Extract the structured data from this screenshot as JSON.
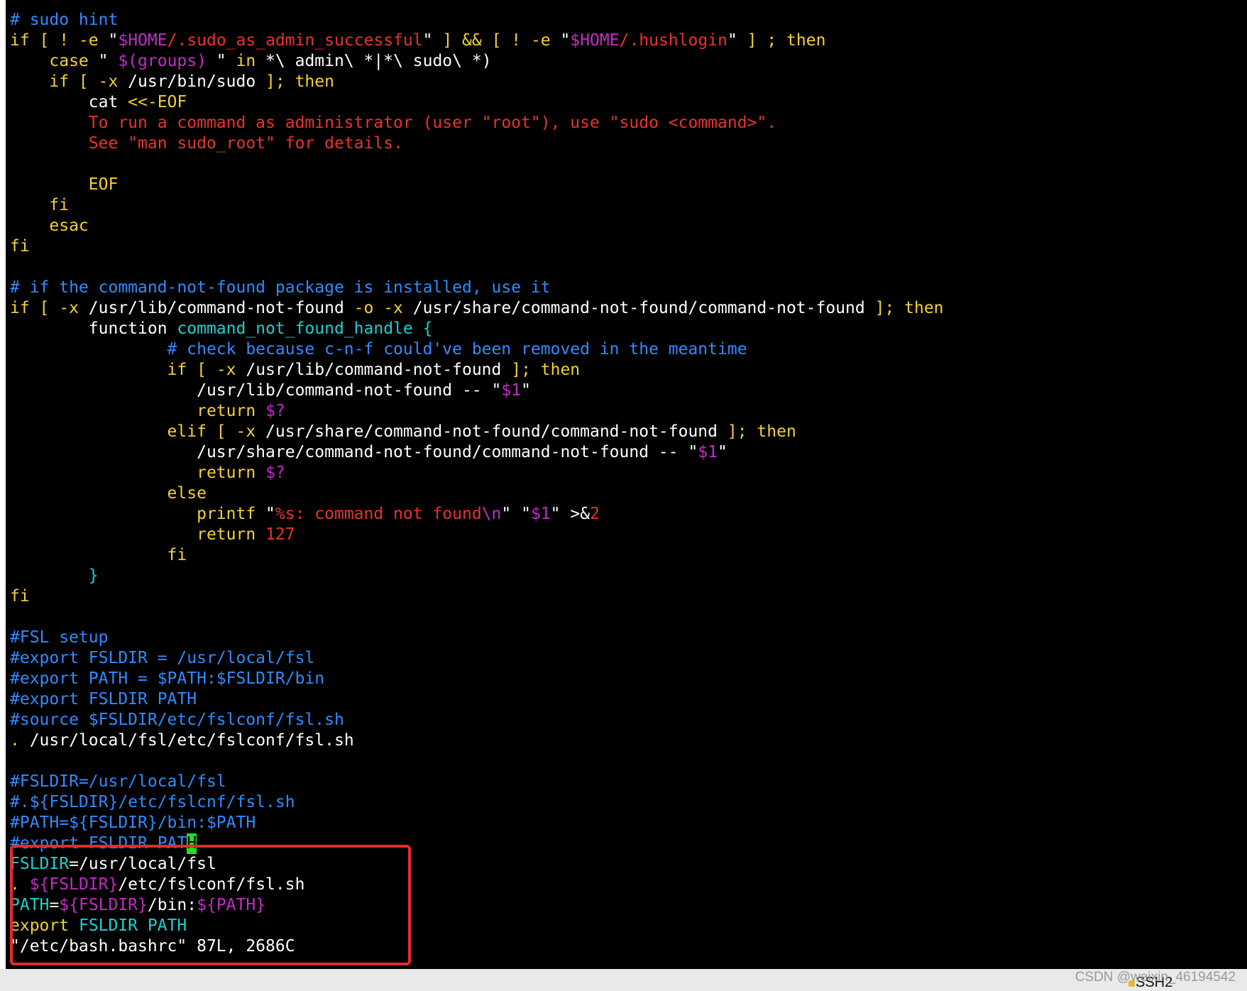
{
  "palette": {
    "default": "#ffffff",
    "keyword": "#f2d03a",
    "comment": "#2f8cff",
    "string": "#e8332d",
    "variable": "#c42ac8",
    "identifier": "#19d2d2",
    "cursor": "#21e021",
    "highlight_box": "#e62a2a"
  },
  "terminal": {
    "lines": [
      [
        {
          "t": "# sudo hint",
          "c": "comment"
        }
      ],
      [
        {
          "t": "if [ ! -e ",
          "c": "keyword"
        },
        {
          "t": "\"",
          "c": "default"
        },
        {
          "t": "$HOME",
          "c": "variable"
        },
        {
          "t": "/.sudo_as_admin_successful",
          "c": "string"
        },
        {
          "t": "\"",
          "c": "default"
        },
        {
          "t": " ] && [ ! -e ",
          "c": "keyword"
        },
        {
          "t": "\"",
          "c": "default"
        },
        {
          "t": "$HOME",
          "c": "variable"
        },
        {
          "t": "/.hushlogin",
          "c": "string"
        },
        {
          "t": "\"",
          "c": "default"
        },
        {
          "t": " ] ; then",
          "c": "keyword"
        }
      ],
      [
        {
          "t": "    case ",
          "c": "keyword"
        },
        {
          "t": "\" ",
          "c": "default"
        },
        {
          "t": "$(groups)",
          "c": "variable"
        },
        {
          "t": " \" ",
          "c": "default"
        },
        {
          "t": "in",
          "c": "keyword"
        },
        {
          "t": " *\\ admin\\ *|*\\ sudo\\ *)",
          "c": "default"
        }
      ],
      [
        {
          "t": "    if [ -x ",
          "c": "keyword"
        },
        {
          "t": "/usr/bin/sudo",
          "c": "default"
        },
        {
          "t": " ]; then",
          "c": "keyword"
        }
      ],
      [
        {
          "t": "        cat ",
          "c": "default"
        },
        {
          "t": "<<-EOF",
          "c": "keyword"
        }
      ],
      [
        {
          "t": "        To run a command as administrator (user \"root\"), use \"sudo <command>\".",
          "c": "string"
        }
      ],
      [
        {
          "t": "        See \"man sudo_root\" for details.",
          "c": "string"
        }
      ],
      [
        {
          "t": "",
          "c": "default"
        }
      ],
      [
        {
          "t": "        EOF",
          "c": "keyword"
        }
      ],
      [
        {
          "t": "    fi",
          "c": "keyword"
        }
      ],
      [
        {
          "t": "    esac",
          "c": "keyword"
        }
      ],
      [
        {
          "t": "fi",
          "c": "keyword"
        }
      ],
      [
        {
          "t": "",
          "c": "default"
        }
      ],
      [
        {
          "t": "# if the command-not-found package is installed, use it",
          "c": "comment"
        }
      ],
      [
        {
          "t": "if [ -x ",
          "c": "keyword"
        },
        {
          "t": "/usr/lib/command-not-found",
          "c": "default"
        },
        {
          "t": " -o -x ",
          "c": "keyword"
        },
        {
          "t": "/usr/share/command-not-found/command-not-found",
          "c": "default"
        },
        {
          "t": " ]; then",
          "c": "keyword"
        }
      ],
      [
        {
          "t": "        function ",
          "c": "default"
        },
        {
          "t": "command_not_found_handle {",
          "c": "identifier"
        }
      ],
      [
        {
          "t": "                # check because c-n-f could've been removed in the meantime",
          "c": "comment"
        }
      ],
      [
        {
          "t": "                if [ -x ",
          "c": "keyword"
        },
        {
          "t": "/usr/lib/command-not-found",
          "c": "default"
        },
        {
          "t": " ]; then",
          "c": "keyword"
        }
      ],
      [
        {
          "t": "                   /usr/lib/command-not-found -- ",
          "c": "default"
        },
        {
          "t": "\"",
          "c": "default"
        },
        {
          "t": "$1",
          "c": "variable"
        },
        {
          "t": "\"",
          "c": "default"
        }
      ],
      [
        {
          "t": "                   return ",
          "c": "keyword"
        },
        {
          "t": "$?",
          "c": "variable"
        }
      ],
      [
        {
          "t": "                elif [ -x ",
          "c": "keyword"
        },
        {
          "t": "/usr/share/command-not-found/command-not-found",
          "c": "default"
        },
        {
          "t": " ]; then",
          "c": "keyword"
        }
      ],
      [
        {
          "t": "                   /usr/share/command-not-found/command-not-found -- ",
          "c": "default"
        },
        {
          "t": "\"",
          "c": "default"
        },
        {
          "t": "$1",
          "c": "variable"
        },
        {
          "t": "\"",
          "c": "default"
        }
      ],
      [
        {
          "t": "                   return ",
          "c": "keyword"
        },
        {
          "t": "$?",
          "c": "variable"
        }
      ],
      [
        {
          "t": "                else",
          "c": "keyword"
        }
      ],
      [
        {
          "t": "                   printf ",
          "c": "keyword"
        },
        {
          "t": "\"",
          "c": "default"
        },
        {
          "t": "%s: command not found",
          "c": "string"
        },
        {
          "t": "\\n",
          "c": "variable"
        },
        {
          "t": "\" ",
          "c": "default"
        },
        {
          "t": "\"",
          "c": "default"
        },
        {
          "t": "$1",
          "c": "variable"
        },
        {
          "t": "\" ",
          "c": "default"
        },
        {
          "t": ">&",
          "c": "default"
        },
        {
          "t": "2",
          "c": "string"
        }
      ],
      [
        {
          "t": "                   return ",
          "c": "keyword"
        },
        {
          "t": "127",
          "c": "string"
        }
      ],
      [
        {
          "t": "                fi",
          "c": "keyword"
        }
      ],
      [
        {
          "t": "        }",
          "c": "identifier"
        }
      ],
      [
        {
          "t": "fi",
          "c": "keyword"
        }
      ],
      [
        {
          "t": "",
          "c": "default"
        }
      ],
      [
        {
          "t": "#FSL setup",
          "c": "comment"
        }
      ],
      [
        {
          "t": "#export FSLDIR = /usr/local/fsl",
          "c": "comment"
        }
      ],
      [
        {
          "t": "#export PATH = $PATH:$FSLDIR/bin",
          "c": "comment"
        }
      ],
      [
        {
          "t": "#export FSLDIR PATH",
          "c": "comment"
        }
      ],
      [
        {
          "t": "#source $FSLDIR/etc/fslconf/fsl.sh",
          "c": "comment"
        }
      ],
      [
        {
          "t": ". ",
          "c": "keyword"
        },
        {
          "t": "/usr/local/fsl/etc/fslconf/fsl.sh",
          "c": "default"
        }
      ],
      [
        {
          "t": "",
          "c": "default"
        }
      ],
      [
        {
          "t": "#FSLDIR=/usr/local/fsl",
          "c": "comment"
        }
      ],
      [
        {
          "t": "#.${FSLDIR}/etc/fslcnf/fsl.sh",
          "c": "comment"
        }
      ],
      [
        {
          "t": "#PATH=${FSLDIR}/bin:$PATH",
          "c": "comment"
        }
      ],
      [
        {
          "t": "#export FSLDIR PAT",
          "c": "comment"
        },
        {
          "t": "H",
          "c": "cursor"
        }
      ],
      [
        {
          "t": "FSLDIR",
          "c": "identifier"
        },
        {
          "t": "=/usr/local/fsl",
          "c": "default"
        }
      ],
      [
        {
          "t": ". ",
          "c": "keyword"
        },
        {
          "t": "${FSLDIR}",
          "c": "variable"
        },
        {
          "t": "/etc/fslconf/fsl.sh",
          "c": "default"
        }
      ],
      [
        {
          "t": "PATH",
          "c": "identifier"
        },
        {
          "t": "=",
          "c": "default"
        },
        {
          "t": "${FSLDIR}",
          "c": "variable"
        },
        {
          "t": "/bin:",
          "c": "default"
        },
        {
          "t": "${PATH}",
          "c": "variable"
        }
      ],
      [
        {
          "t": "export ",
          "c": "keyword"
        },
        {
          "t": "FSLDIR PATH",
          "c": "identifier"
        }
      ],
      [
        {
          "t": "\"/etc/bash.bashrc\" 87L, 2686C",
          "c": "default"
        }
      ]
    ]
  },
  "status_bar": {
    "session_label": "SSH2",
    "watermark": "CSDN @weixin_46194542"
  }
}
